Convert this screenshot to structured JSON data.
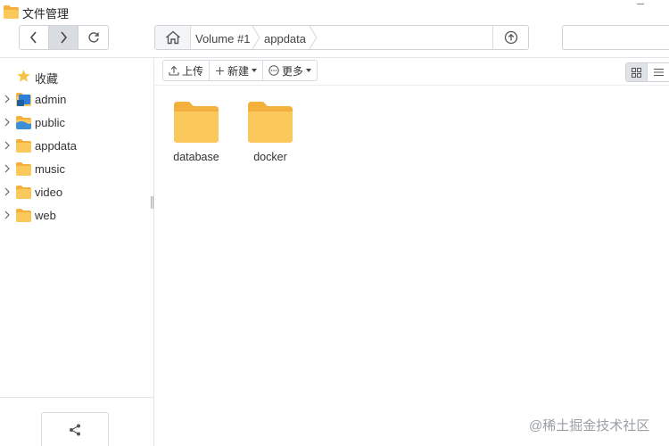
{
  "window": {
    "title": "文件管理"
  },
  "nav": {
    "back": "back",
    "forward": "forward",
    "refresh": "refresh"
  },
  "path": {
    "crumbs": [
      "Volume #1",
      "appdata"
    ]
  },
  "search": {
    "value": ""
  },
  "sidebar": {
    "items": [
      {
        "label": "收藏",
        "icon": "star-icon",
        "expandable": false
      },
      {
        "label": "admin",
        "icon": "user-folder-icon",
        "expandable": true
      },
      {
        "label": "public",
        "icon": "shared-folder-icon",
        "expandable": true
      },
      {
        "label": "appdata",
        "icon": "folder-icon",
        "expandable": true
      },
      {
        "label": "music",
        "icon": "folder-icon",
        "expandable": true
      },
      {
        "label": "video",
        "icon": "folder-icon",
        "expandable": true
      },
      {
        "label": "web",
        "icon": "folder-icon",
        "expandable": true
      }
    ]
  },
  "actions": {
    "upload": "上传",
    "new": "新建",
    "more": "更多"
  },
  "files": [
    {
      "name": "database",
      "icon": "folder-icon"
    },
    {
      "name": "docker",
      "icon": "folder-icon"
    }
  ],
  "watermark": "@稀土掘金技术社区",
  "colors": {
    "folder": "#fbc85b",
    "folder_dark": "#f3b03d",
    "accent_blue": "#2f7fd8"
  }
}
